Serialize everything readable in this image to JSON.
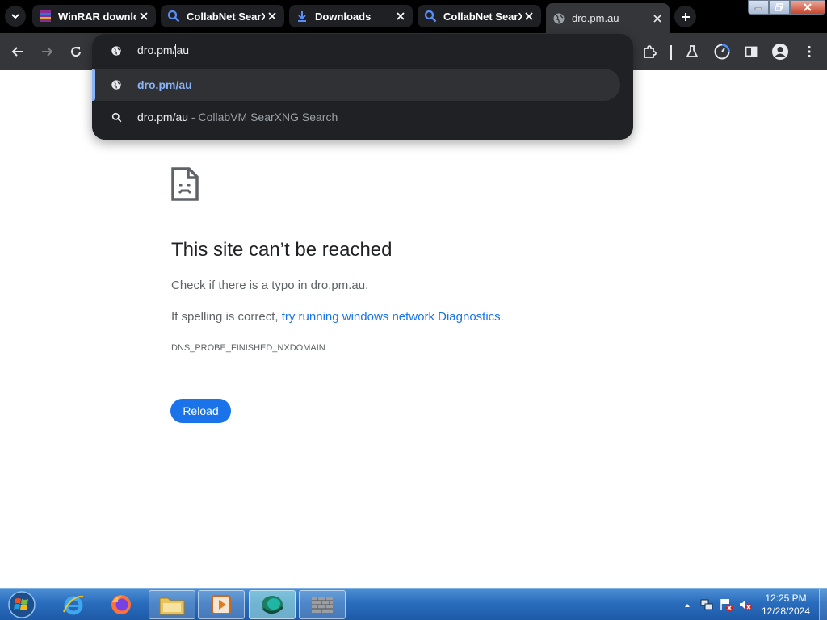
{
  "browser": {
    "tabs": [
      {
        "title": "WinRAR downlo",
        "favicon": "winrar-icon"
      },
      {
        "title": "CollabNet SearX",
        "favicon": "search-icon"
      },
      {
        "title": "Downloads",
        "favicon": "download-icon"
      },
      {
        "title": "CollabNet SearX",
        "favicon": "search-icon"
      },
      {
        "title": "dro.pm.au",
        "favicon": "globe-icon",
        "active": true
      }
    ],
    "omnibox": {
      "typed_before_caret": "dro.pm/",
      "typed_after_caret": "au",
      "suggestions": [
        {
          "text": "dro.pm/au",
          "icon": "globe-icon",
          "selected": true
        },
        {
          "text": "dro.pm/au",
          "separator": " - ",
          "description": "CollabVM SearXNG Search",
          "icon": "search-icon"
        }
      ]
    }
  },
  "error_page": {
    "title": "This site can’t be reached",
    "line1": "Check if there is a typo in dro.pm.au.",
    "line2_prefix": "If spelling is correct, ",
    "line2_link": "try running windows network Diagnostics",
    "line2_suffix": ".",
    "error_code": "DNS_PROBE_FINISHED_NXDOMAIN",
    "reload_label": "Reload"
  },
  "taskbar": {
    "time": "12:25 PM",
    "date": "12/28/2024"
  },
  "colors": {
    "tabstrip": "#000000",
    "toolbar": "#35363a",
    "omnibox_bg": "#202124",
    "link_blue": "#1a73e8",
    "suggest_link": "#8ab4f8"
  }
}
